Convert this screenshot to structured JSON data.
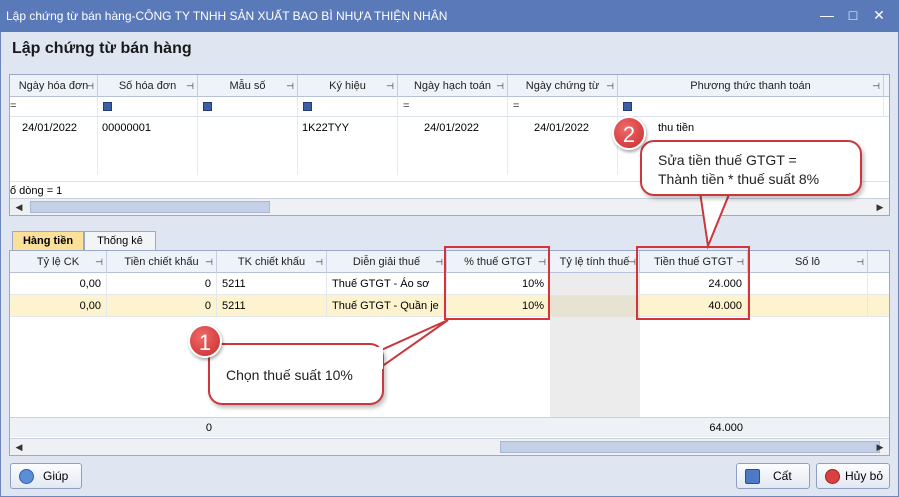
{
  "window": {
    "title": "Lập chứng từ bán hàng-CÔNG TY TNHH SẢN XUẤT BAO BÌ NHỰA THIỆN NHÂN",
    "minimize": "—",
    "restore": "□",
    "close": "✕"
  },
  "form_title": "Lập chứng từ bán hàng",
  "top_grid": {
    "headers": [
      "Ngày hóa đơn",
      "Số hóa đơn",
      "Mẫu số",
      "Ký hiệu",
      "Ngày hạch toán",
      "Ngày chứng từ",
      "Phương thức thanh toán"
    ],
    "filter_eq": "=",
    "row": {
      "ngay_hoa_don": "24/01/2022",
      "so_hoa_don": "00000001",
      "mau_so": "",
      "ky_hieu": "1K22TYY",
      "ngay_hach_toan": "24/01/2022",
      "ngay_chung_tu": "24/01/2022",
      "phuong_thuc": "thu tiền"
    },
    "row_count": "ố dòng = 1"
  },
  "tabs": [
    {
      "label": "Hàng tiền",
      "active": true
    },
    {
      "label": "Thống kê",
      "active": false
    }
  ],
  "bottom_grid": {
    "headers": [
      "Tỷ lệ CK",
      "Tiền chiết khấu",
      "TK chiết khấu",
      "Diễn giải thuế",
      "% thuế GTGT",
      "Tỷ lệ tính thuế",
      "Tiền thuế GTGT",
      "Số lô"
    ],
    "rows": [
      {
        "ty_le_ck": "0,00",
        "tien_ck": "0",
        "tk_ck": "5211",
        "dien_giai": "Thuế GTGT - Áo sơ",
        "pct_thue": "10%",
        "ty_le_tinh": "",
        "tien_thue": "24.000",
        "so_lo": ""
      },
      {
        "ty_le_ck": "0,00",
        "tien_ck": "0",
        "tk_ck": "5211",
        "dien_giai": "Thuế GTGT - Quần je",
        "pct_thue": "10%",
        "ty_le_tinh": "",
        "tien_thue": "40.000",
        "so_lo": ""
      }
    ],
    "totals": {
      "tien_ck": "0",
      "tien_thue": "64.000"
    }
  },
  "callouts": {
    "one": {
      "num": "1",
      "text": "Chọn thuế suất 10%"
    },
    "two": {
      "num": "2",
      "line1": "Sửa tiền thuế GTGT =",
      "line2": "Thành tiền * thuế suất 8%"
    }
  },
  "buttons": {
    "help": "Giúp",
    "save": "Cất",
    "cancel": "Hủy bỏ"
  },
  "colors": {
    "titlebar": "#5a79b9",
    "tab_active": "#fbe09a",
    "highlight": "#d6343a",
    "selected_row": "#fdf3cf"
  }
}
